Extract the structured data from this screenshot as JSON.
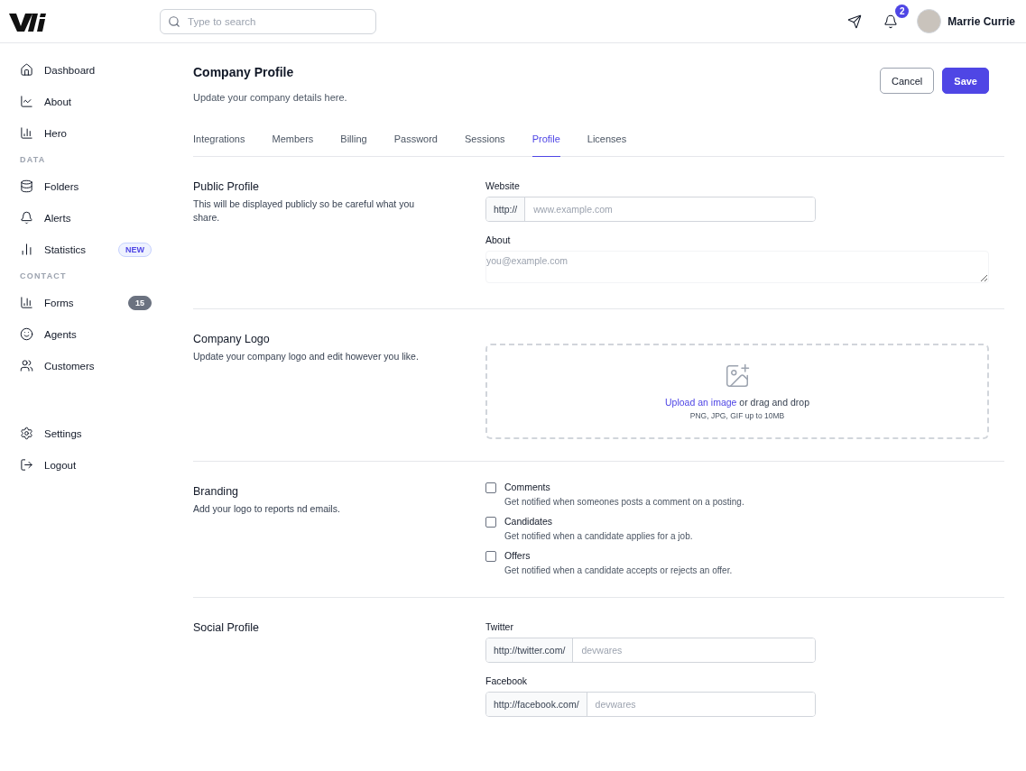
{
  "header": {
    "search": {
      "placeholder": "Type to search"
    },
    "notifications": "2",
    "user": "Marrie Currie"
  },
  "sidebar": {
    "sections": [
      {
        "items": [
          {
            "label": "Dashboard"
          },
          {
            "label": "About"
          },
          {
            "label": "Hero"
          }
        ]
      },
      {
        "heading": "DATA",
        "items": [
          {
            "label": "Folders"
          },
          {
            "label": "Alerts"
          },
          {
            "label": "Statistics",
            "badge": {
              "text": "NEW",
              "kind": "new"
            }
          }
        ]
      },
      {
        "heading": "CONTACT",
        "items": [
          {
            "label": "Forms",
            "badge": {
              "text": "15",
              "kind": "count"
            }
          },
          {
            "label": "Agents"
          },
          {
            "label": "Customers"
          }
        ]
      },
      {
        "items": [
          {
            "label": "Settings"
          },
          {
            "label": "Logout"
          }
        ]
      }
    ]
  },
  "page": {
    "title": "Company Profile",
    "subtitle": "Update your company details here.",
    "buttons": [
      {
        "label": "Cancel",
        "kind": "secondary"
      },
      {
        "label": "Save",
        "kind": "primary"
      }
    ]
  },
  "tabs": [
    {
      "label": "Integrations",
      "selected": false
    },
    {
      "label": "Members",
      "selected": false
    },
    {
      "label": "Billing",
      "selected": false
    },
    {
      "label": "Password",
      "selected": false
    },
    {
      "label": "Sessions",
      "selected": false
    },
    {
      "label": "Profile",
      "selected": true
    },
    {
      "label": "Licenses",
      "selected": false
    }
  ],
  "sections": [
    {
      "title": "Public Profile",
      "description": "This will be displayed publicly so be careful what you share.",
      "content": [
        {
          "kind": "addon",
          "label": "Website",
          "prefix": "http://",
          "placeholder": "www.example.com"
        },
        {
          "kind": "textarea",
          "label": "About",
          "placeholder": "you@example.com"
        }
      ]
    },
    {
      "title": "Company Logo",
      "description": "Update your company logo and edit however you like.",
      "content": [
        {
          "kind": "upload",
          "link": "Upload an image",
          "text": "or drag and drop",
          "hint": "PNG, JPG, GIF up to 10MB"
        }
      ]
    },
    {
      "title": "Branding",
      "description": "Add your logo to reports nd emails.",
      "content": [
        {
          "kind": "checkbox",
          "label": "Comments",
          "hint": "Get notified when someones posts a comment on a posting.",
          "checked": false
        },
        {
          "kind": "checkbox",
          "label": "Candidates",
          "hint": "Get notified when a candidate applies for a job.",
          "checked": false
        },
        {
          "kind": "checkbox",
          "label": "Offers",
          "hint": "Get notified when a candidate accepts or rejects an offer.",
          "checked": false
        }
      ]
    },
    {
      "title": "Social Profile",
      "content": [
        {
          "kind": "addon",
          "label": "Twitter",
          "prefix": "http://twitter.com/",
          "placeholder": "devwares"
        },
        {
          "kind": "addon",
          "label": "Facebook",
          "prefix": "http://facebook.com/",
          "placeholder": "devwares"
        }
      ]
    }
  ]
}
